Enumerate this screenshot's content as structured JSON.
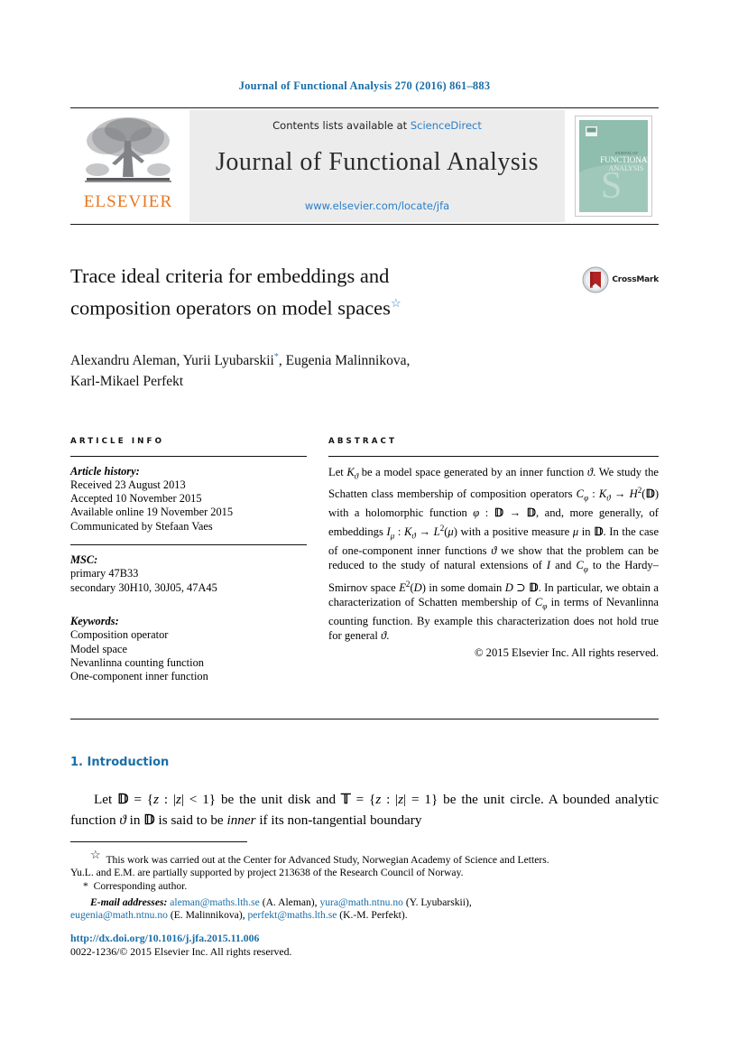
{
  "running_head": "Journal of Functional Analysis 270 (2016) 861–883",
  "masthead": {
    "publisher_name": "ELSEVIER",
    "publisher_logo_alt": "elsevier-tree-logo",
    "contents_prefix": "Contents lists available at ",
    "contents_link": "ScienceDirect",
    "journal_name": "Journal of Functional Analysis",
    "journal_url": "www.elsevier.com/locate/jfa",
    "cover": {
      "line1": "JOURNAL OF",
      "line2": "FUNCTIONAL",
      "line3": "ANALYSIS",
      "bg_color": "#8fbdae"
    },
    "accent_link_color": "#2a7fc9",
    "elsevier_orange": "#E87722"
  },
  "article": {
    "title_line1": "Trace ideal criteria for embeddings and",
    "title_line2": "composition operators on model spaces",
    "title_footnote_marker": "☆",
    "authors_line1_a": "Alexandru Aleman, Yurii Lyubarskii",
    "authors_corresponding_marker": "*",
    "authors_line1_b": ", Eugenia Malinnikova,",
    "authors_line2": "Karl-Mikael Perfekt",
    "crossmark_label": "CrossMark"
  },
  "info": {
    "heading": "ARTICLE INFO",
    "history_label": "Article history:",
    "history": [
      "Received 23 August 2013",
      "Accepted 10 November 2015",
      "Available online 19 November 2015",
      "Communicated by Stefaan Vaes"
    ],
    "msc_label": "MSC:",
    "msc": [
      "primary 47B33",
      "secondary 30H10, 30J05, 47A45"
    ],
    "keywords_label": "Keywords:",
    "keywords": [
      "Composition operator",
      "Model space",
      "Nevanlinna counting function",
      "One-component inner function"
    ]
  },
  "abstract": {
    "heading": "ABSTRACT",
    "copyright": "© 2015 Elsevier Inc. All rights reserved."
  },
  "section": {
    "number_title": "1.  Introduction"
  },
  "footnotes": {
    "star_marker": "☆",
    "star_text_line1": "This work was carried out at the Center for Advanced Study, Norwegian Academy of Science and Letters.",
    "star_text_line2": "Yu.L. and E.M. are partially supported by project 213638 of the Research Council of Norway.",
    "corresponding_marker": "*",
    "corresponding_text": "Corresponding author.",
    "email_label": "E-mail addresses:",
    "emails": [
      {
        "address": "aleman@maths.lth.se",
        "owner": "(A. Aleman)"
      },
      {
        "address": "yura@math.ntnu.no",
        "owner": "(Y. Lyubarskii)"
      },
      {
        "address": "eugenia@math.ntnu.no",
        "owner": "(E. Malinnikova)"
      },
      {
        "address": "perfekt@maths.lth.se",
        "owner": "(K.-M. Perfekt)"
      }
    ]
  },
  "publication": {
    "doi_url": "http://dx.doi.org/10.1016/j.jfa.2015.11.006",
    "issn_line": "0022-1236/© 2015 Elsevier Inc. All rights reserved.",
    "link_color": "#1a6ea8"
  }
}
